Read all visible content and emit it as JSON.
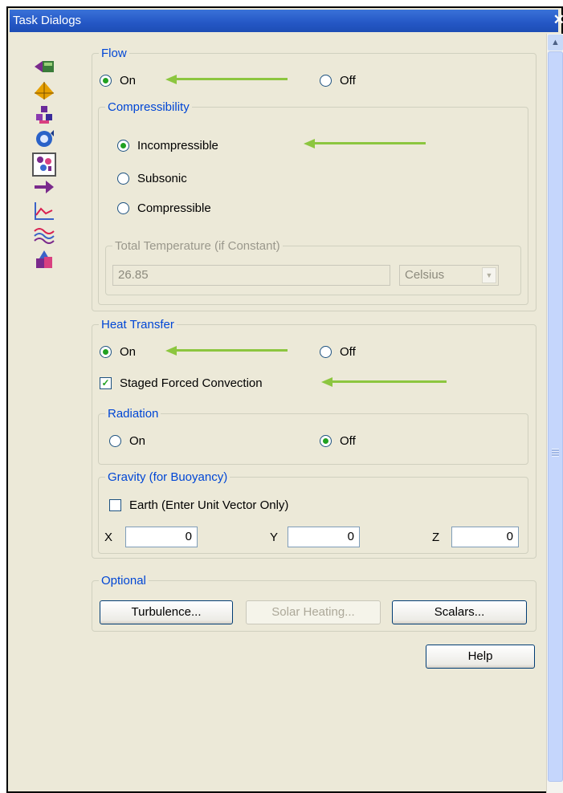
{
  "window": {
    "title": "Task Dialogs"
  },
  "sidebar": {
    "icons": [
      "flow-icon",
      "geometry-icon",
      "materials-icon",
      "rotation-icon",
      "physics-icon",
      "forward-arrow-icon",
      "chart-icon",
      "waves-icon",
      "heat-source-icon"
    ]
  },
  "flow": {
    "legend": "Flow",
    "on_label": "On",
    "off_label": "Off",
    "selected": "On",
    "compressibility": {
      "legend": "Compressibility",
      "options": [
        "Incompressible",
        "Subsonic",
        "Compressible"
      ],
      "selected": "Incompressible",
      "total_temperature": {
        "legend": "Total Temperature (if Constant)",
        "value": "26.85",
        "unit": "Celsius"
      }
    }
  },
  "heat_transfer": {
    "legend": "Heat Transfer",
    "on_label": "On",
    "off_label": "Off",
    "selected": "On",
    "staged_forced_convection": {
      "label": "Staged Forced Convection",
      "checked": true
    },
    "radiation": {
      "legend": "Radiation",
      "on_label": "On",
      "off_label": "Off",
      "selected": "Off"
    },
    "gravity": {
      "legend": "Gravity (for Buoyancy)",
      "earth_label": "Earth (Enter Unit Vector Only)",
      "earth_checked": false,
      "x_label": "X",
      "x_value": "0",
      "y_label": "Y",
      "y_value": "0",
      "z_label": "Z",
      "z_value": "0"
    }
  },
  "optional": {
    "legend": "Optional",
    "turbulence_label": "Turbulence...",
    "solar_heating_label": "Solar Heating...",
    "scalars_label": "Scalars..."
  },
  "help_label": "Help",
  "annotation_color": "#8cc63f"
}
